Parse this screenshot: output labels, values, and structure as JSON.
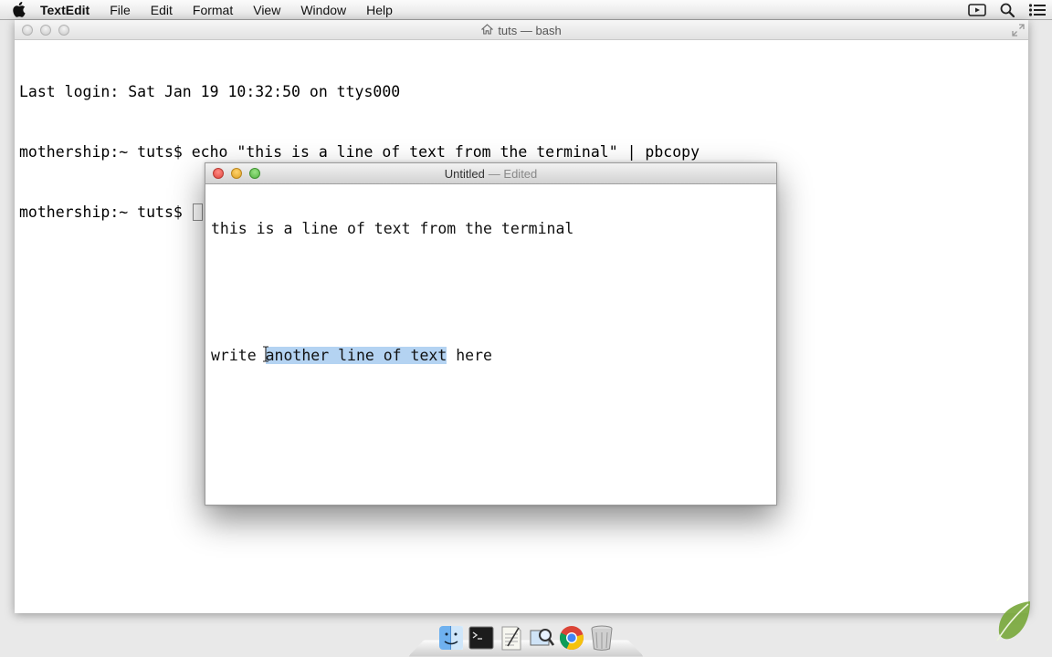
{
  "menubar": {
    "app_name": "TextEdit",
    "items": [
      "File",
      "Edit",
      "Format",
      "View",
      "Window",
      "Help"
    ],
    "right_icons": [
      "video-camera-icon",
      "spotlight-search-icon",
      "notification-center-icon"
    ]
  },
  "terminal": {
    "title": "tuts — bash",
    "lines": [
      "Last login: Sat Jan 19 10:32:50 on ttys000",
      "mothership:~ tuts$ echo \"this is a line of text from the terminal\" | pbcopy",
      "mothership:~ tuts$ "
    ]
  },
  "textedit": {
    "title": "Untitled",
    "edited_label": "— Edited",
    "line1": "this is a line of text from the terminal",
    "line2_before": "write ",
    "line2_selected": "another line of text",
    "line2_after": " here"
  },
  "dock": {
    "icons": [
      "finder-icon",
      "terminal-icon",
      "textedit-icon",
      "preview-icon",
      "chrome-icon",
      "trash-icon"
    ]
  },
  "colors": {
    "selection": "#b4d3f2",
    "close": "#e0443e",
    "minimize": "#dea123",
    "zoom": "#55b443"
  }
}
